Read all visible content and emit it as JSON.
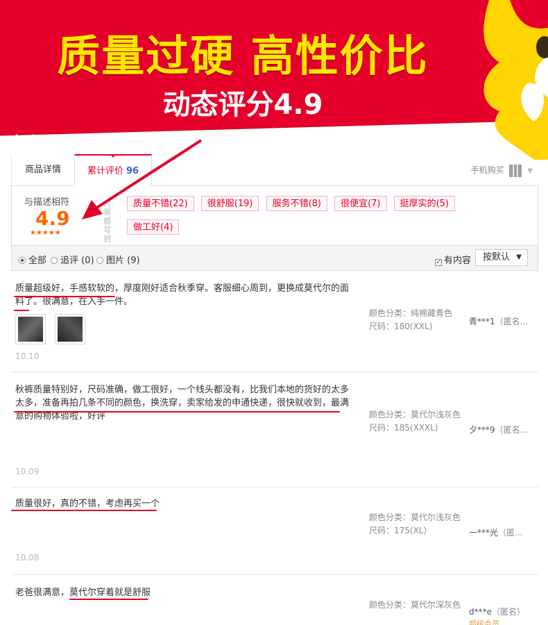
{
  "banner": {
    "title": "质量过硬 高性价比",
    "subtitle": "动态评分4.9",
    "colors": {
      "red": "#e4002b",
      "yellow": "#ffe600"
    }
  },
  "tabs": {
    "detail": "商品详情",
    "reviews": "累计评价",
    "review_count": "96",
    "mobile_buy": "手机购买"
  },
  "rating": {
    "label": "与描述相符",
    "score": "4.9",
    "stars": "★★★★★",
    "side_text": "大家都写到",
    "tags": [
      "质量不错(22)",
      "很舒服(19)",
      "服务不错(8)",
      "很便宜(7)",
      "挺厚实的(5)",
      "做工好(4)"
    ]
  },
  "filter": {
    "all": "全部",
    "append": "追评 (0)",
    "images": "图片 (9)",
    "has_content": "有内容",
    "sort": "按默认"
  },
  "reviews": [
    {
      "text": "质量超级好，手感软软的，厚度刚好适合秋季穿。客服细心周到，更换成莫代尔的面料了。很满意，在入手一件。",
      "date": "10.10",
      "color": "颜色分类：纯棉藏青色",
      "size": "尺码：180(XXL)",
      "user": "青***1",
      "anon": "（匿名..."
    },
    {
      "text": "秋裤质量特别好，尺码准确，做工很好，一个线头都没有，比我们本地的货好的太多太多，准备再拍几条不同的颜色，换洗穿，卖家给发的申通快递，很快就收到，最满意的购物体验啦，好评",
      "date": "10.09",
      "color": "颜色分类：莫代尔浅灰色",
      "size": "尺码：185(XXXL)",
      "user": "夕***9",
      "anon": "（匿名..."
    },
    {
      "text": "质量很好，真的不错，考虑再买一个",
      "date": "10.08",
      "color": "颜色分类：莫代尔浅灰色",
      "size": "尺码：175(XL)",
      "user": "一***光",
      "anon": "（匿..."
    },
    {
      "text": "老爸很满意，莫代尔穿着就是舒服",
      "date": "",
      "color": "颜色分类：莫代尔深灰色",
      "size": "",
      "user": "d***e",
      "anon": "（匿名）",
      "level": "超级会员"
    }
  ]
}
